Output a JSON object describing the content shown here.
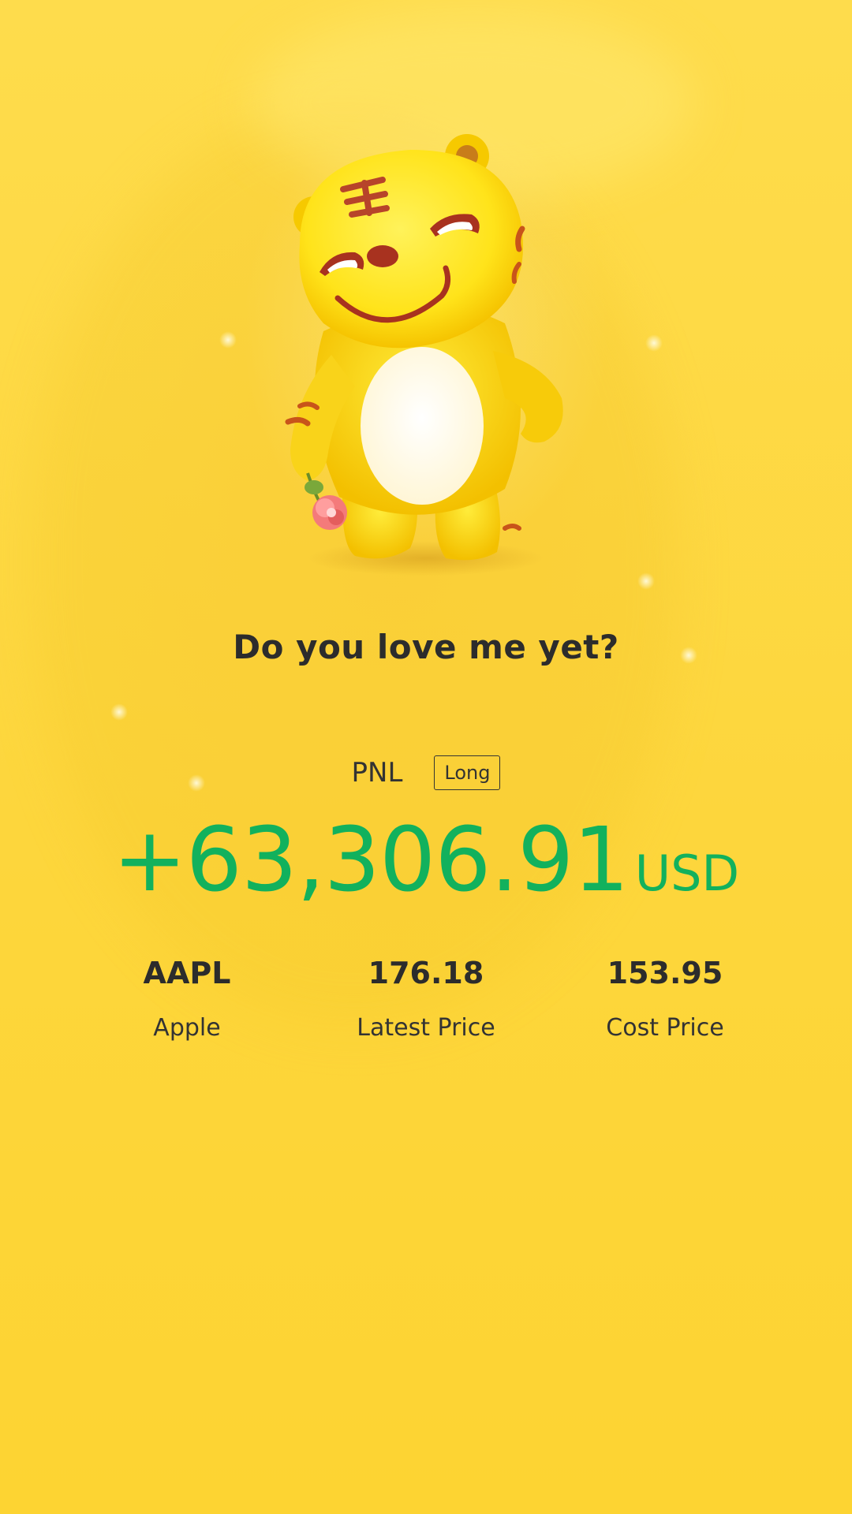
{
  "theme": {
    "background": "#fdd63c",
    "accent_positive": "#12b15d",
    "text_primary": "#2c2c2c"
  },
  "mascot": {
    "icon": "tiger-mascot-holding-flower"
  },
  "headline": "Do you love me yet?",
  "pnl": {
    "label": "PNL",
    "position_type": "Long",
    "value": "+63,306.91",
    "currency": "USD"
  },
  "stats": {
    "symbol": {
      "value": "AAPL",
      "label": "Apple"
    },
    "latest_price": {
      "value": "176.18",
      "label": "Latest Price"
    },
    "cost_price": {
      "value": "153.95",
      "label": "Cost Price"
    }
  }
}
